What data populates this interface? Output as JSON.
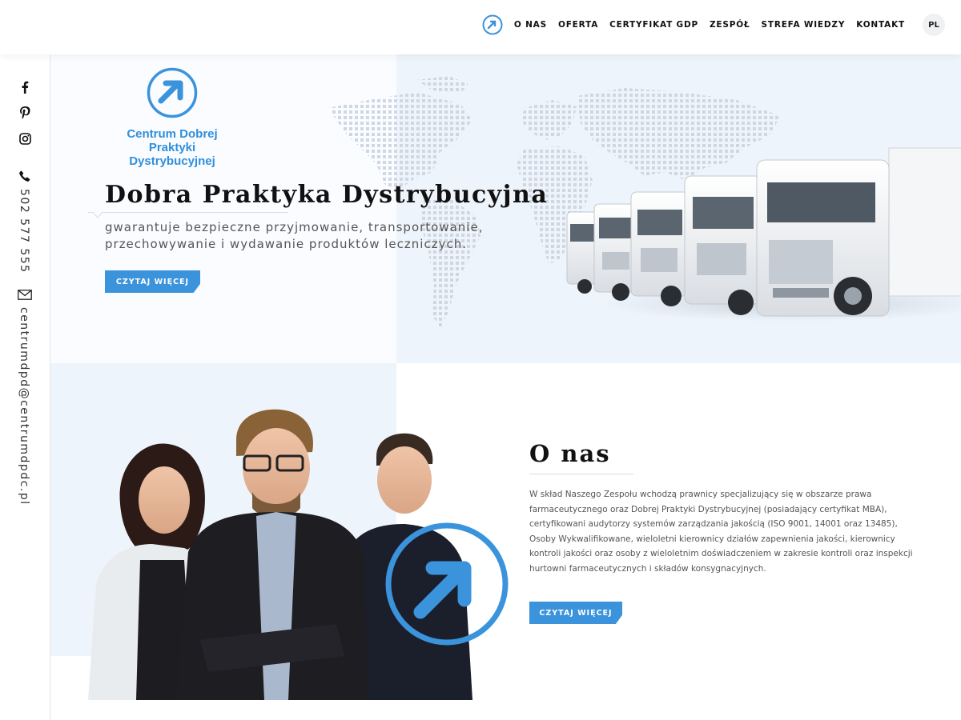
{
  "nav": {
    "items": [
      "O NAS",
      "OFERTA",
      "CERTYFIKAT GDP",
      "ZESPÓŁ",
      "STREFA WIEDZY",
      "KONTAKT"
    ],
    "lang": "PL"
  },
  "side": {
    "phone": "502 577 555",
    "email": "centrumdpd@centrumdpdc.pl"
  },
  "brand": {
    "line1": "Centrum Dobrej",
    "line2": "Praktyki Dystrybucyjnej"
  },
  "hero": {
    "title": "Dobra Praktyka Dystrybucyjna",
    "subtitle_line1": "gwarantuje bezpieczne przyjmowanie, transportowanie,",
    "subtitle_line2": "przechowywanie i wydawanie produktów leczniczych.",
    "button": "CZYTAJ WIĘCEJ"
  },
  "about": {
    "title": "O nas",
    "text": "W skład Naszego Zespołu wchodzą prawnicy specjalizujący się w obszarze prawa farmaceutycznego oraz Dobrej Praktyki Dystrybucyjnej (posiadający certyfikat MBA), certyfikowani audytorzy systemów zarządzania jakością (ISO 9001, 14001 oraz 13485), Osoby Wykwalifikowane, wieloletni kierownicy działów zapewnienia jakości, kierownicy kontroli jakości oraz osoby z wieloletnim doświadczeniem w zakresie kontroli oraz inspekcji hurtowni farmaceutycznych i składów konsygnacyjnych.",
    "button": "CZYTAJ WIĘCEJ"
  },
  "colors": {
    "accent": "#3b93dc",
    "light_bg": "#eef4fb"
  },
  "icons": [
    "facebook-icon",
    "pinterest-icon",
    "instagram-icon",
    "phone-icon",
    "mail-icon",
    "logo-arrow-icon"
  ]
}
